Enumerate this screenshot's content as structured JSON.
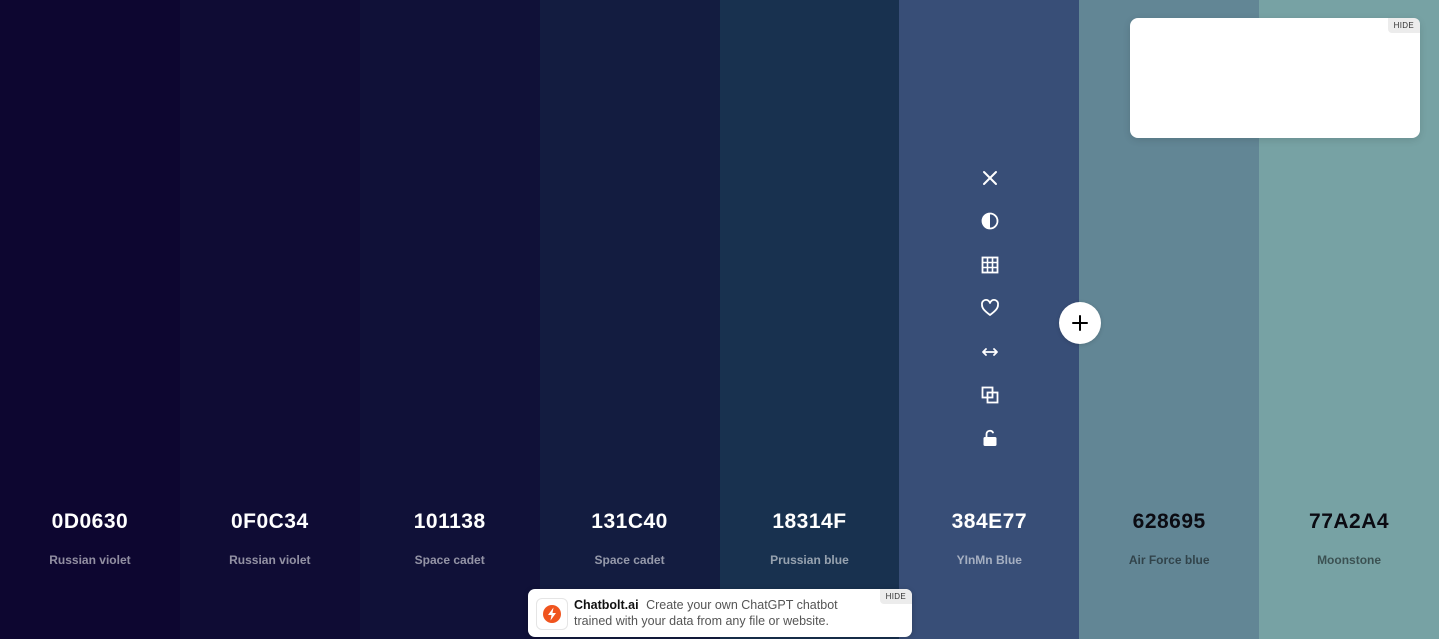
{
  "palette": [
    {
      "hex": "0D0630",
      "name": "Russian violet",
      "bg": "#0D0630",
      "text_theme": "light"
    },
    {
      "hex": "0F0C34",
      "name": "Russian violet",
      "bg": "#0F0C34",
      "text_theme": "light"
    },
    {
      "hex": "101138",
      "name": "Space cadet",
      "bg": "#101138",
      "text_theme": "light"
    },
    {
      "hex": "131C40",
      "name": "Space cadet",
      "bg": "#131C40",
      "text_theme": "light"
    },
    {
      "hex": "18314F",
      "name": "Prussian blue",
      "bg": "#18314F",
      "text_theme": "light"
    },
    {
      "hex": "384E77",
      "name": "YInMn Blue",
      "bg": "#384E77",
      "text_theme": "light"
    },
    {
      "hex": "628695",
      "name": "Air Force blue",
      "bg": "#628695",
      "text_theme": "dark"
    },
    {
      "hex": "77A2A4",
      "name": "Moonstone",
      "bg": "#77A2A4",
      "text_theme": "dark"
    }
  ],
  "toolbar": {
    "icons": [
      "close-icon",
      "contrast-icon",
      "grid-icon",
      "heart-icon",
      "drag-arrows-icon",
      "copy-icon",
      "unlock-icon"
    ]
  },
  "add_button": {
    "icon": "plus-icon"
  },
  "ads": {
    "top": {
      "hide_label": "HIDE"
    },
    "bottom": {
      "hide_label": "HIDE",
      "brand": "Chatbolt.ai",
      "text": "Create your own ChatGPT chatbot trained with your data from any file or website."
    }
  }
}
